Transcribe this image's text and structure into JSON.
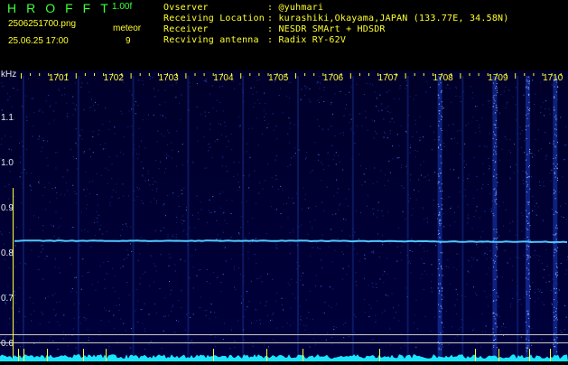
{
  "header": {
    "brand": "HROFFT",
    "version": "1.00f",
    "filename": "2506251700.png",
    "datetime": "25.06.25 17:00",
    "meteor_label": "meteor",
    "meteor_count": "9",
    "info": [
      {
        "label": "Ovserver",
        "value": ": @yuhmari"
      },
      {
        "label": "Receiving Location",
        "value": ": kurashiki,Okayama,JAPAN (133.77E, 34.58N)"
      },
      {
        "label": "Receiver",
        "value": ": NESDR SMArt + HDSDR"
      },
      {
        "label": "Recviving antenna",
        "value": ": Radix RY-62V"
      }
    ]
  },
  "colors": {
    "header_text": "#3cff3c",
    "info_text": "#ffff30",
    "waterfall_bg": "#00002a",
    "signal": "#4fc7ff",
    "time_label": "#ffff30",
    "freq_label": "#e8e8e8"
  },
  "chart_data": {
    "type": "heatmap",
    "y_unit_label": "kHz",
    "time_labels": [
      "1701",
      "1702",
      "1703",
      "1704",
      "1705",
      "1706",
      "1707",
      "1708",
      "1709",
      "1710"
    ],
    "freq_labels": [
      "1.1",
      "1.0",
      "0.9",
      "0.8",
      "0.7",
      "0.6"
    ],
    "y_values": [
      1.1,
      1.0,
      0.9,
      0.8,
      0.7,
      0.6
    ],
    "ylim": [
      0.58,
      1.16
    ],
    "carrier_khz": 0.825,
    "bright_columns_minutes": [
      1708.0,
      1709.0,
      1709.6,
      1710.1
    ],
    "meteor_count": 9
  }
}
